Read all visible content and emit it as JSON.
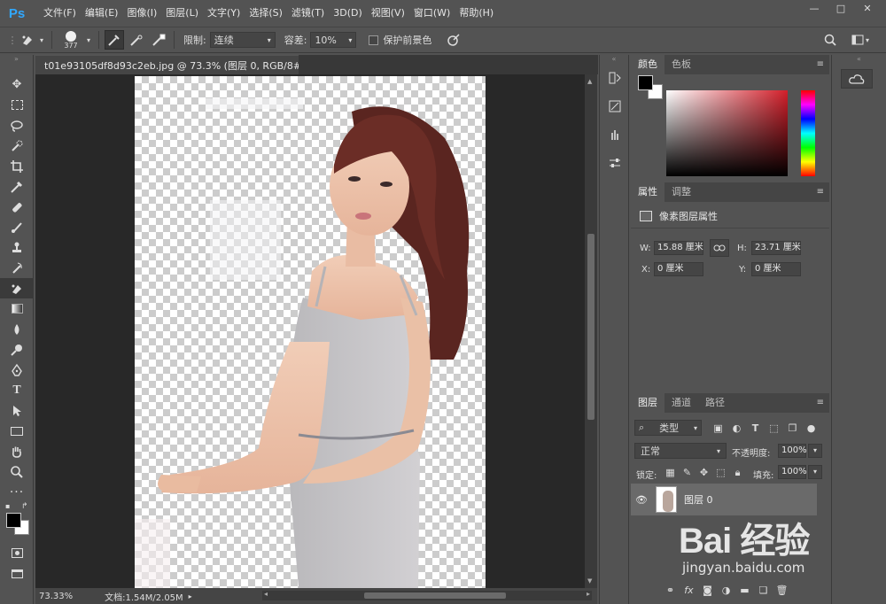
{
  "app": {
    "logo": "Ps"
  },
  "menu": [
    "文件(F)",
    "编辑(E)",
    "图像(I)",
    "图层(L)",
    "文字(Y)",
    "选择(S)",
    "滤镜(T)",
    "3D(D)",
    "视图(V)",
    "窗口(W)",
    "帮助(H)"
  ],
  "window_controls": {
    "minimize": "—",
    "maximize": "□",
    "close": "✕"
  },
  "options": {
    "brush_size": "377",
    "limit_label": "限制:",
    "limit_value": "连续",
    "tolerance_label": "容差:",
    "tolerance_value": "10%",
    "protect_fg_label": "保护前景色"
  },
  "document": {
    "tab_title": "t01e93105df8d93c2eb.jpg @ 73.3% (图层 0, RGB/8#) *",
    "tab_close": "×",
    "zoom": "73.33%",
    "doc_info": "文档:1.54M/2.05M"
  },
  "color_panel": {
    "tabs": [
      "颜色",
      "色板"
    ],
    "foreground": "#000000",
    "background": "#ffffff",
    "field_hue": "#d31f2a"
  },
  "properties_panel": {
    "tabs": [
      "属性",
      "调整"
    ],
    "title": "像素图层属性",
    "w_label": "W:",
    "w_value": "15.88 厘米",
    "h_label": "H:",
    "h_value": "23.71 厘米",
    "x_label": "X:",
    "x_value": "0 厘米",
    "y_label": "Y:",
    "y_value": "0 厘米"
  },
  "layers_panel": {
    "tabs": [
      "图层",
      "通道",
      "路径"
    ],
    "filter_label": "类型",
    "blend_mode": "正常",
    "opacity_label": "不透明度:",
    "opacity_value": "100%",
    "lock_label": "锁定:",
    "fill_label": "填充:",
    "fill_value": "100%",
    "layers": [
      {
        "name": "图层 0",
        "visible": true
      }
    ]
  },
  "watermark": {
    "brand": "Bai 经验",
    "url": "jingyan.baidu.com"
  }
}
